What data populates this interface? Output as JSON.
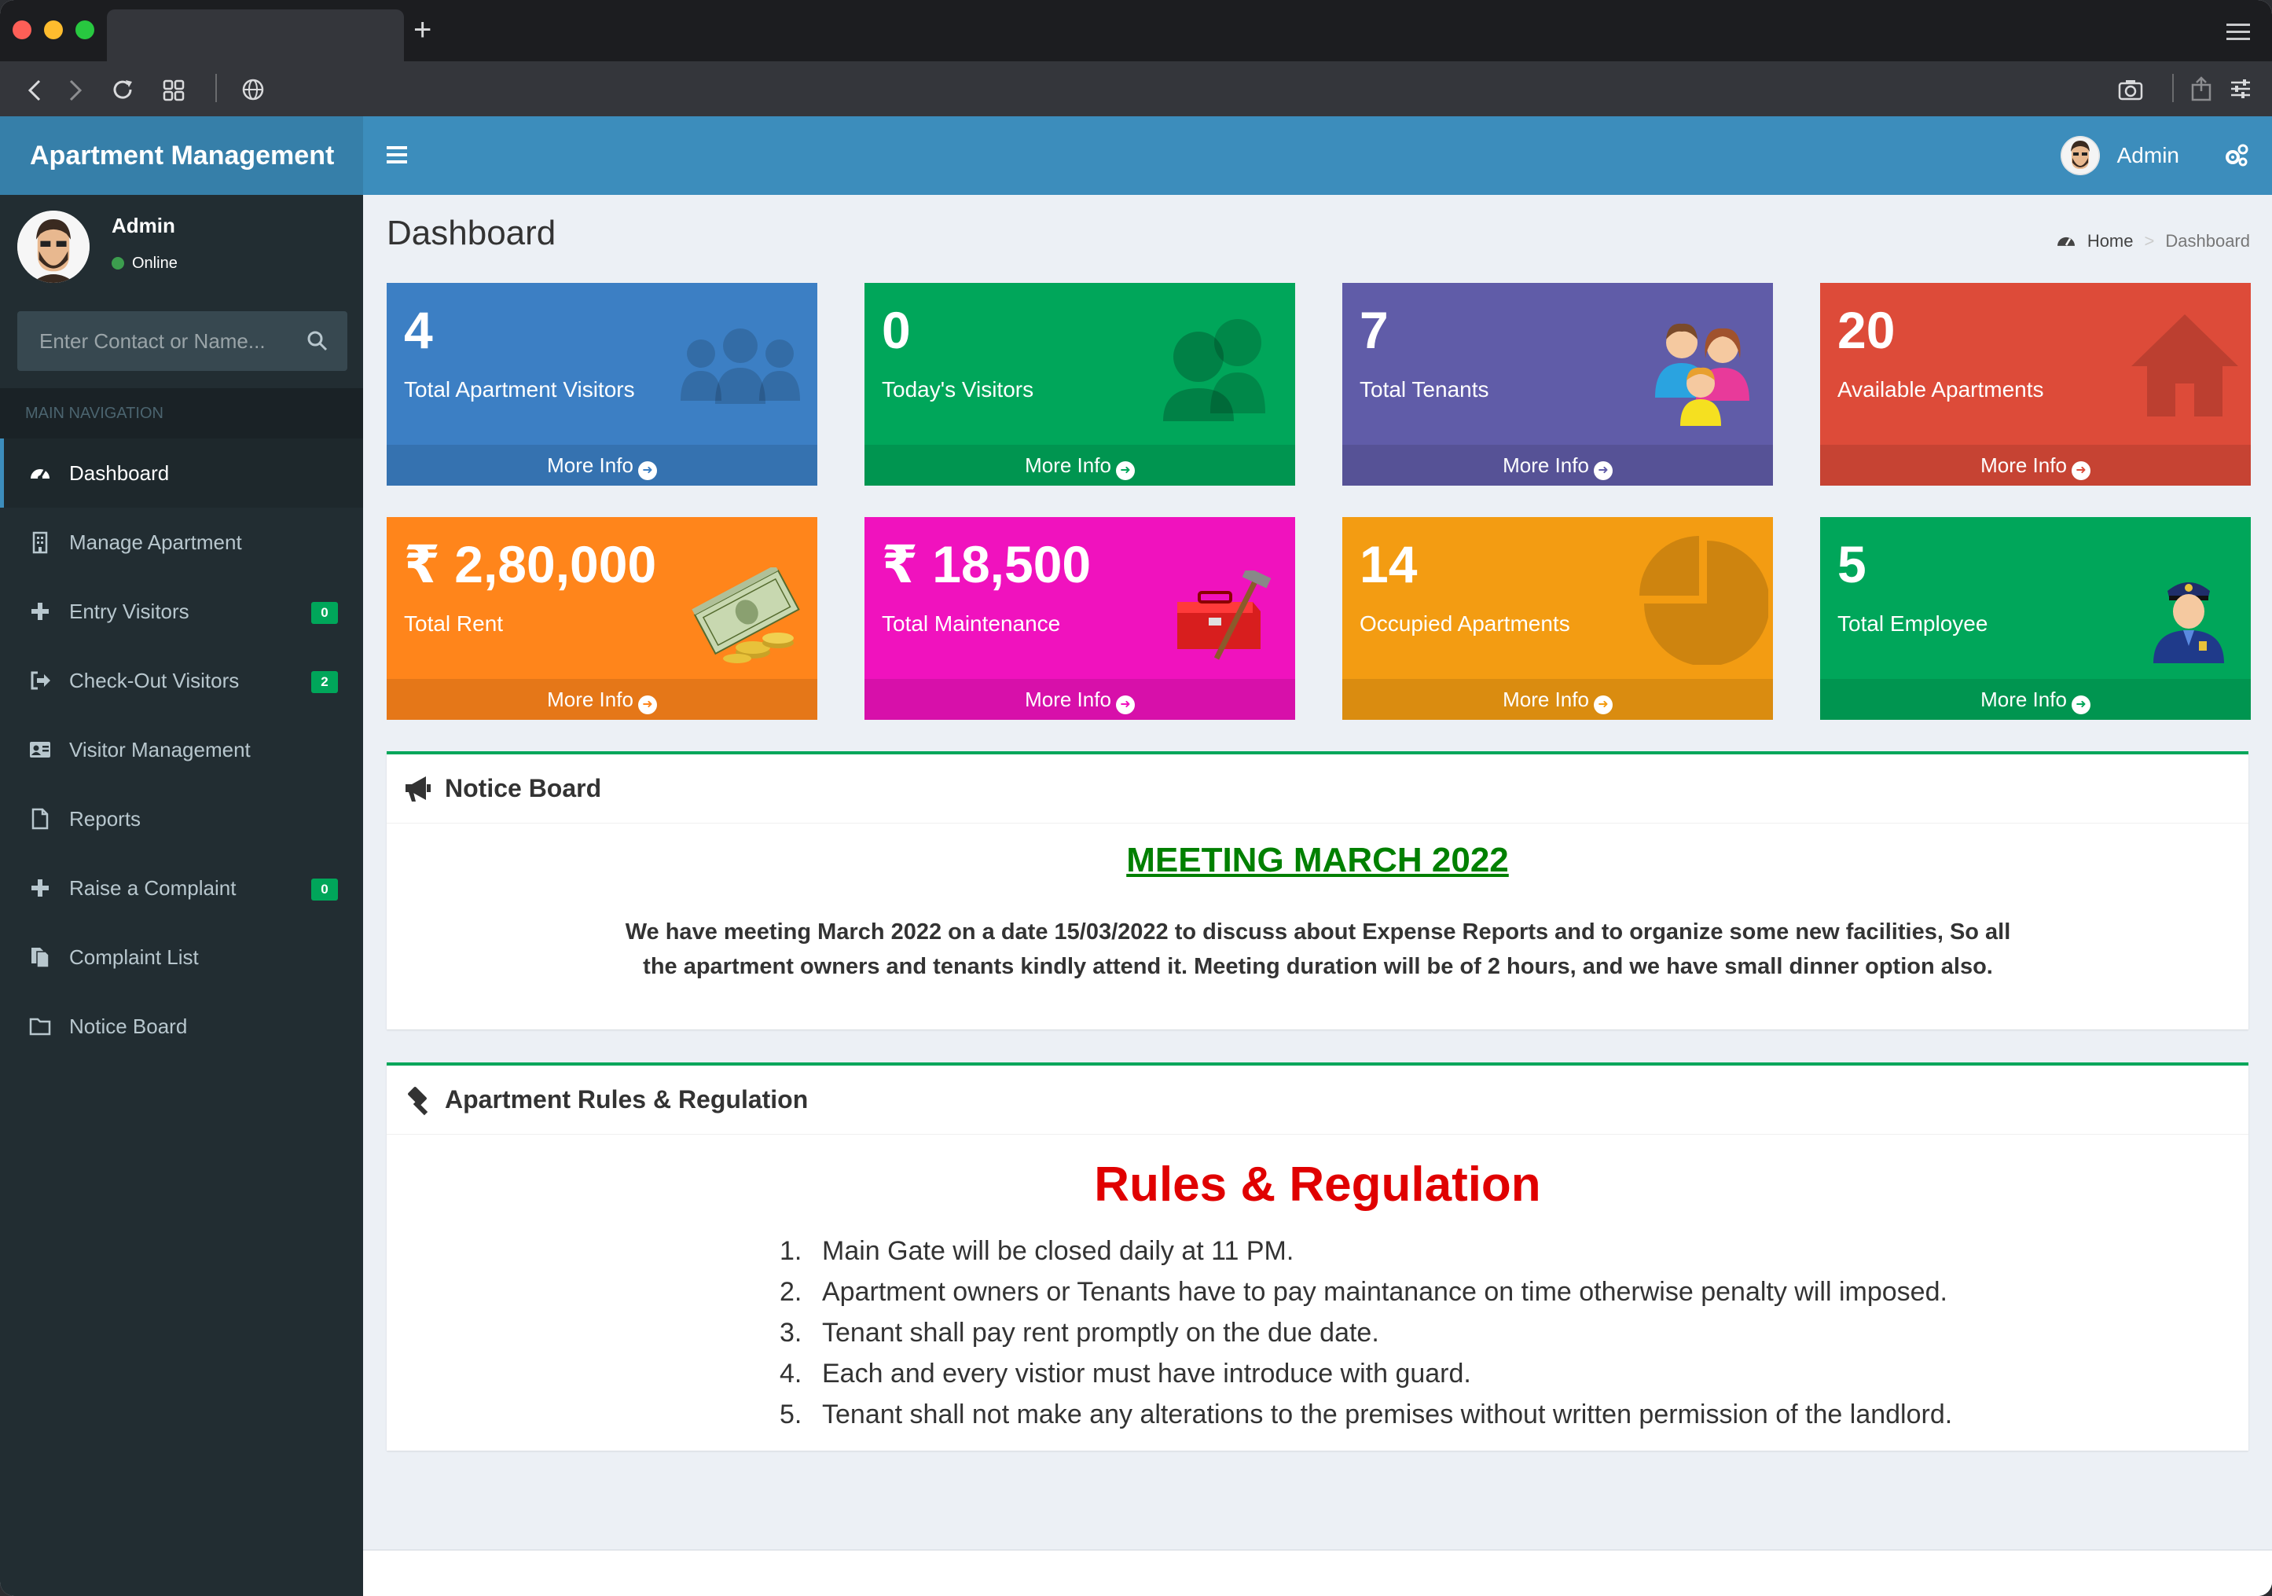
{
  "app": {
    "title": "Apartment Management"
  },
  "header": {
    "user_name": "Admin"
  },
  "sidebar": {
    "user": {
      "name": "Admin",
      "status": "Online"
    },
    "search": {
      "placeholder": "Enter Contact or Name..."
    },
    "nav_header": "MAIN NAVIGATION",
    "items": [
      {
        "label": "Dashboard",
        "icon": "dashboard-icon",
        "active": true
      },
      {
        "label": "Manage Apartment",
        "icon": "building-icon"
      },
      {
        "label": "Entry Visitors",
        "icon": "plus-icon",
        "badge": "0"
      },
      {
        "label": "Check-Out Visitors",
        "icon": "sign-out-icon",
        "badge": "2"
      },
      {
        "label": "Visitor Management",
        "icon": "id-card-icon"
      },
      {
        "label": "Reports",
        "icon": "file-icon"
      },
      {
        "label": "Raise a Complaint",
        "icon": "plus-icon",
        "badge": "0"
      },
      {
        "label": "Complaint List",
        "icon": "files-icon"
      },
      {
        "label": "Notice Board",
        "icon": "folder-icon"
      }
    ]
  },
  "page": {
    "title": "Dashboard",
    "breadcrumb": {
      "home": "Home",
      "current": "Dashboard"
    }
  },
  "tiles": [
    {
      "value": "4",
      "label": "Total Apartment Visitors",
      "more": "More Info",
      "color": "#3c7fc4",
      "icon": "users-icon"
    },
    {
      "value": "0",
      "label": "Today's Visitors",
      "more": "More Info",
      "color": "#00a65a",
      "icon": "visitors-icon"
    },
    {
      "value": "7",
      "label": "Total Tenants",
      "more": "More Info",
      "color": "#605ca8",
      "icon": "family-icon"
    },
    {
      "value": "20",
      "label": "Available Apartments",
      "more": "More Info",
      "color": "#dd4b39",
      "icon": "home-icon"
    },
    {
      "value": "₹ 2,80,000",
      "label": "Total Rent",
      "more": "More Info",
      "color": "#ff851b",
      "icon": "money-icon"
    },
    {
      "value": "₹ 18,500",
      "label": "Total Maintenance",
      "more": "More Info",
      "color": "#f012be",
      "icon": "toolbox-icon"
    },
    {
      "value": "14",
      "label": "Occupied Apartments",
      "more": "More Info",
      "color": "#f39c12",
      "icon": "pie-chart-icon"
    },
    {
      "value": "5",
      "label": "Total Employee",
      "more": "More Info",
      "color": "#00a65a",
      "icon": "guard-icon"
    }
  ],
  "notice": {
    "header": "Notice Board",
    "title": "MEETING MARCH 2022",
    "body": "We have meeting March 2022 on a date 15/03/2022 to discuss about Expense Reports and to organize some new facilities, So all the apartment owners and tenants kindly attend it. Meeting duration will be of 2 hours, and we have small dinner option also."
  },
  "rules": {
    "header": "Apartment Rules & Regulation",
    "title": "Rules & Regulation",
    "items": [
      {
        "n": "1.",
        "text": "Main Gate will be closed daily at 11 PM."
      },
      {
        "n": "2.",
        "text": "Apartment owners or Tenants have to pay maintanance on time otherwise penalty will imposed."
      },
      {
        "n": "3.",
        "text": "Tenant shall pay rent promptly on the due date."
      },
      {
        "n": "4.",
        "text": "Each and every vistior must have introduce with guard."
      },
      {
        "n": "5.",
        "text": "Tenant shall not make any alterations to the premises without written permission of the landlord."
      }
    ]
  }
}
